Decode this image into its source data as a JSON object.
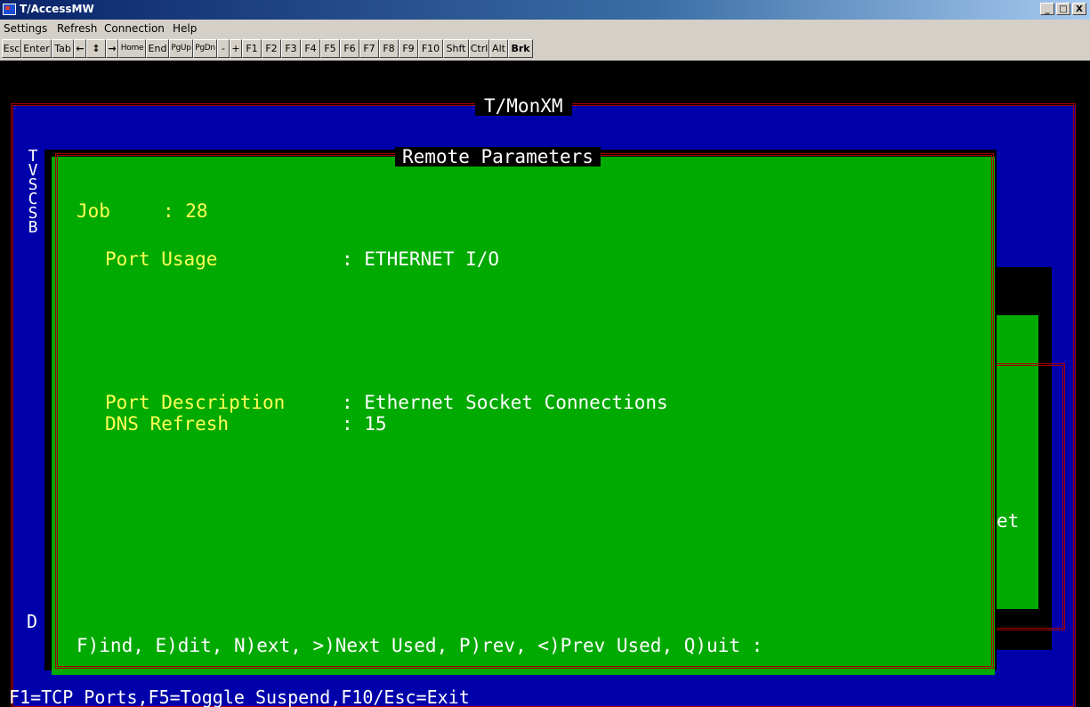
{
  "window": {
    "title": "T/AccessMW",
    "minimize": "_",
    "maximize": "□",
    "close": "X"
  },
  "menu": [
    "Settings",
    "Refresh",
    "Connection",
    "Help"
  ],
  "toolbar": [
    "Esc",
    "Enter",
    "Tab",
    "←",
    "↕",
    "→",
    "Home",
    "End",
    "PgUp",
    "PgDn",
    "-",
    "+",
    "F1",
    "F2",
    "F3",
    "F4",
    "F5",
    "F6",
    "F7",
    "F8",
    "F9",
    "F10",
    "Shft",
    "Ctrl",
    "Alt",
    "Brk"
  ],
  "terminal": {
    "monitor_title": "T/MonXM",
    "left_letters": [
      "T",
      "V",
      "S",
      "C",
      "S",
      "B"
    ],
    "left_bottom_letter": "D",
    "background_text": "et",
    "popup": {
      "title": "Remote Parameters",
      "job_label": "Job",
      "job_value": ": 28",
      "port_usage_label": "Port Usage",
      "port_usage_value": ": ETHERNET I/O",
      "port_description_label": "Port Description",
      "port_description_value": ": Ethernet Socket Connections",
      "dns_refresh_label": "DNS Refresh",
      "dns_refresh_value": ": 15",
      "command_prompt": "F)ind, E)dit, N)ext, >)Next Used, P)rev, <)Prev Used, Q)uit :"
    },
    "status_line": "F1=TCP Ports,F5=Toggle Suspend,F10/Esc=Exit"
  },
  "colors": {
    "terminal_bg": "#0000aa",
    "popup_bg": "#00aa00",
    "label": "#ffff55",
    "value": "#ffffff",
    "frame": "#aa0000"
  }
}
